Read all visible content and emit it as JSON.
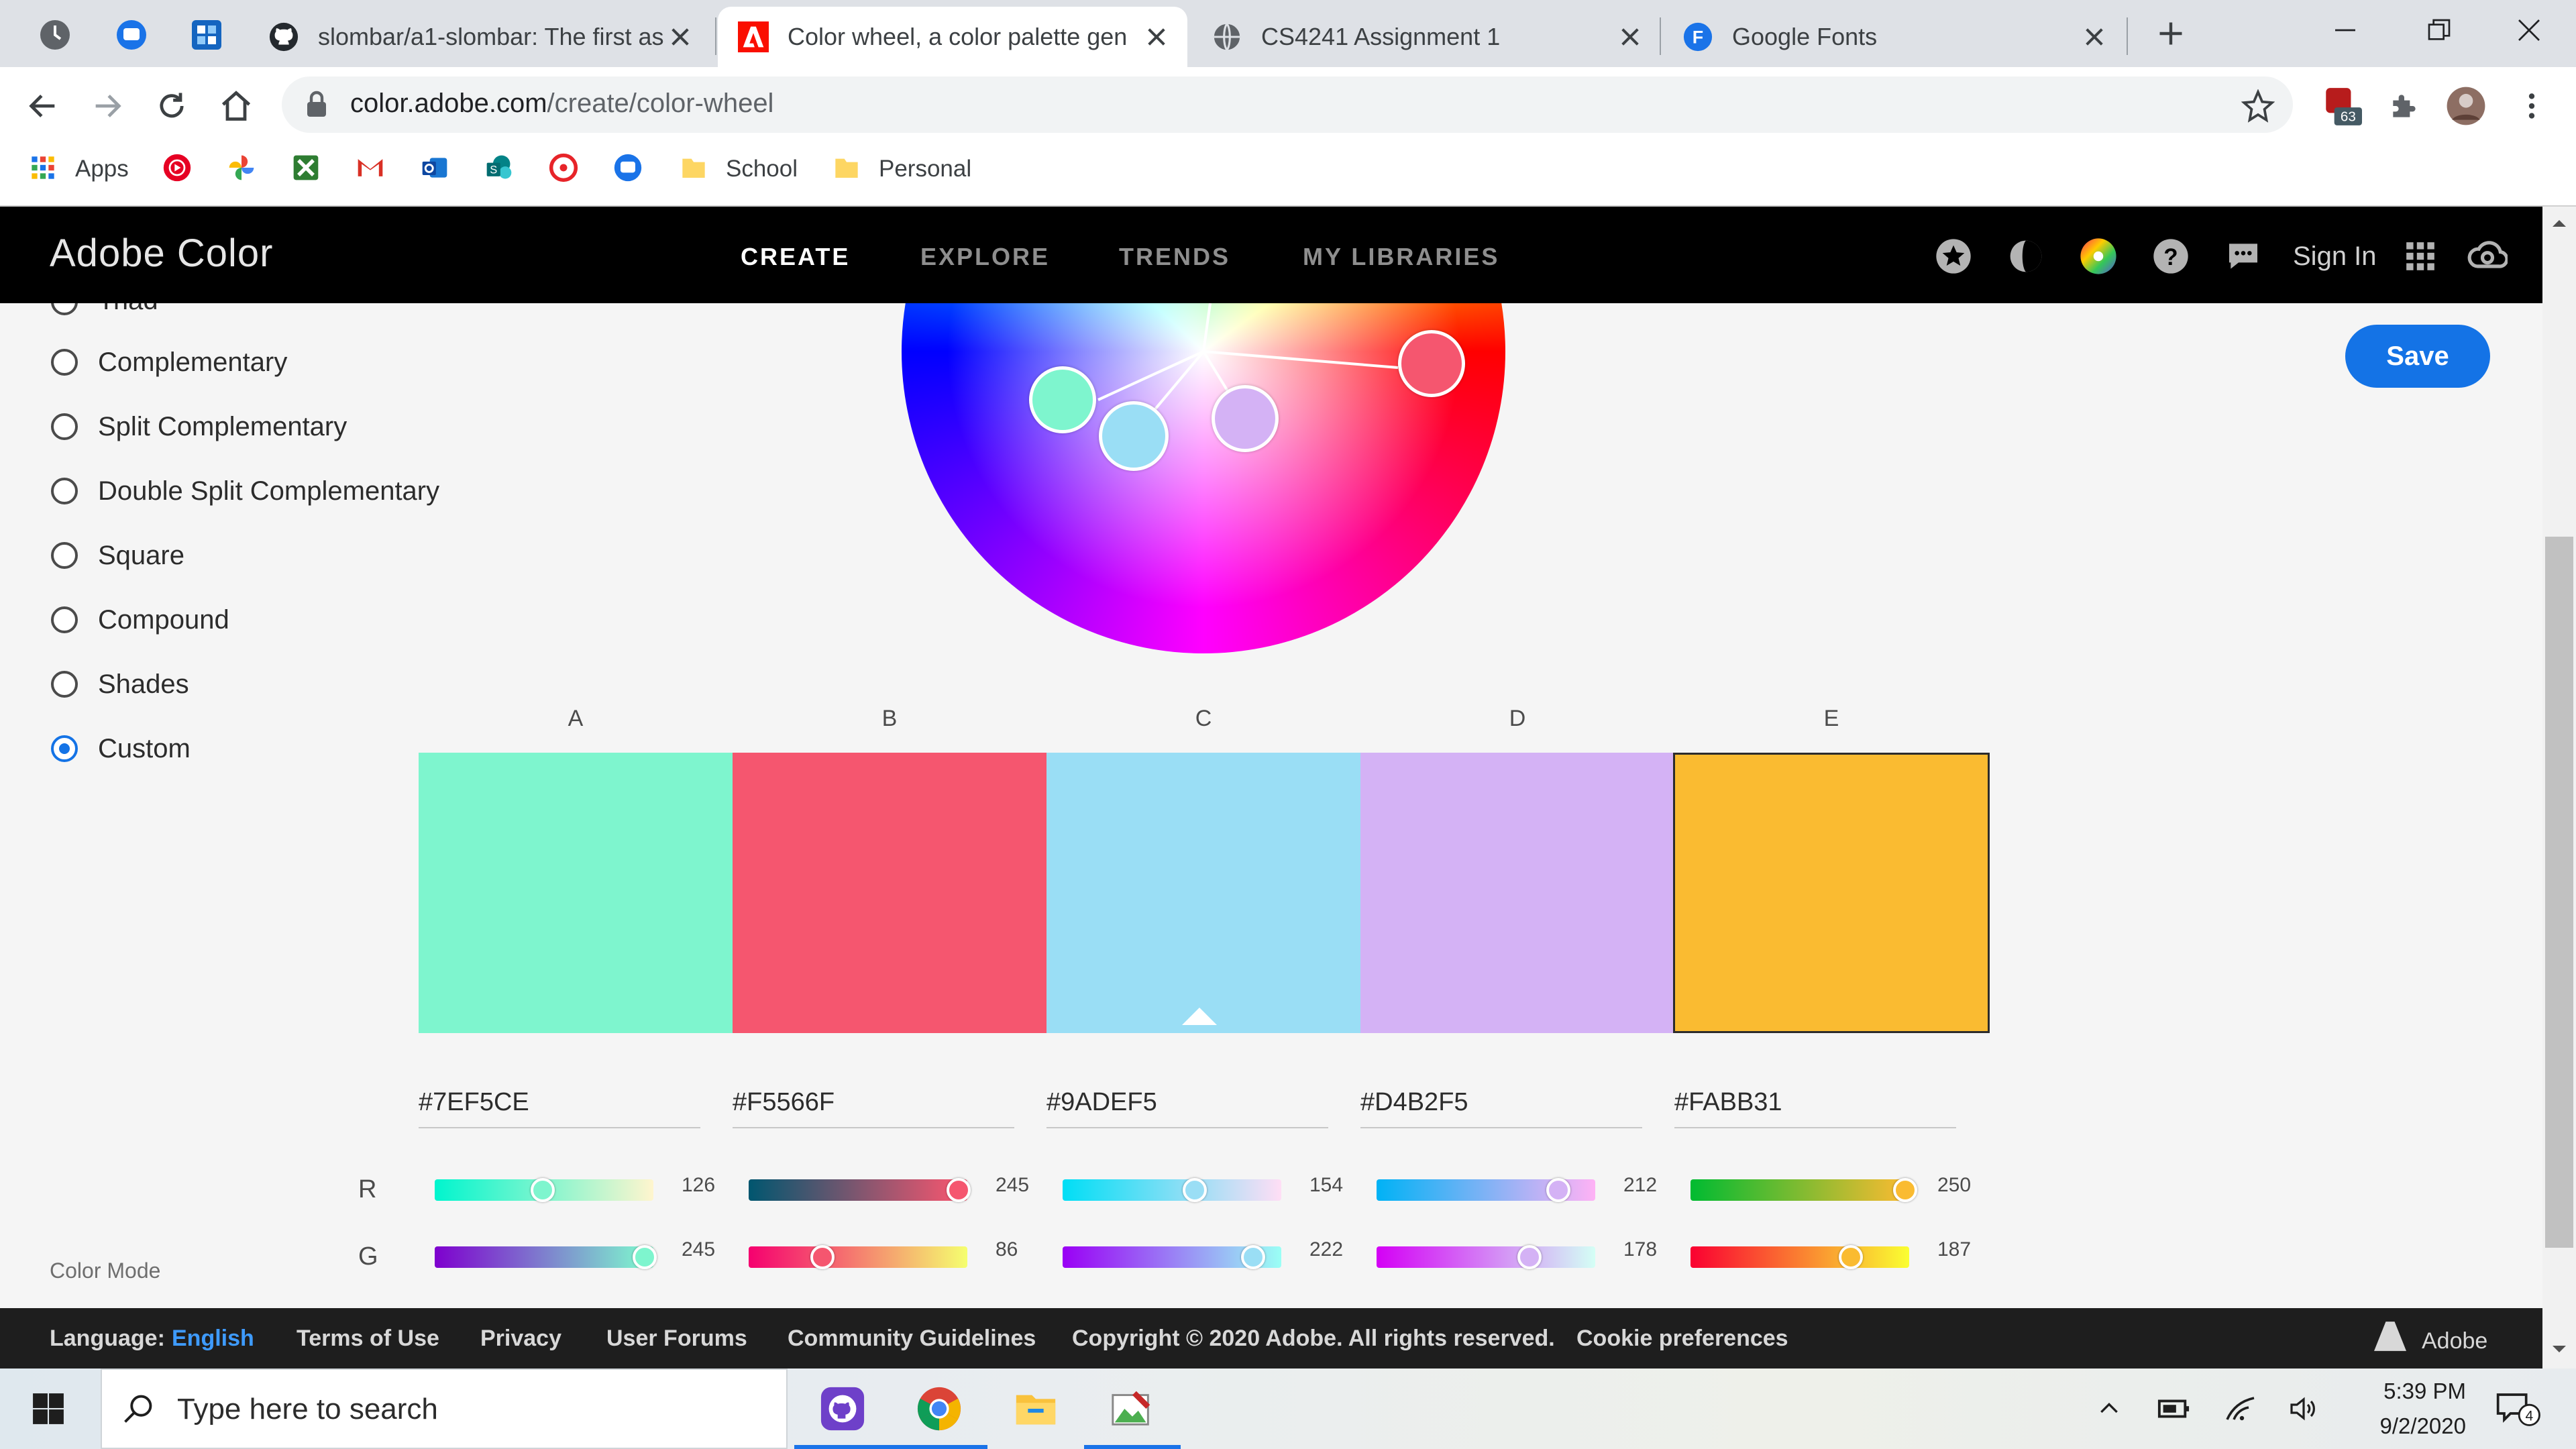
{
  "browser": {
    "tabs": [
      {
        "title": "slombar/a1-slombar: The first as",
        "favicon": "github-icon"
      },
      {
        "title": "Color wheel, a color palette gen",
        "favicon": "adobe-icon",
        "active": true
      },
      {
        "title": "CS4241 Assignment 1",
        "favicon": "globe-icon"
      },
      {
        "title": "Google Fonts",
        "favicon": "google-fonts-icon",
        "favicon_letter": "F"
      }
    ],
    "url_host": "color.adobe.com",
    "url_path": "/create/color-wheel",
    "extension_badge": "63",
    "bookmarks": [
      {
        "label": "Apps",
        "icon": "apps-grid-icon"
      },
      {
        "label": "School",
        "icon": "folder-icon"
      },
      {
        "label": "Personal",
        "icon": "folder-icon"
      }
    ]
  },
  "app": {
    "brand": "Adobe Color",
    "nav": [
      "CREATE",
      "EXPLORE",
      "TRENDS",
      "MY LIBRARIES"
    ],
    "active_nav": "CREATE",
    "sign_in": "Sign In",
    "save": "Save"
  },
  "harmony_rules": {
    "partial_top": "Triad",
    "options": [
      "Complementary",
      "Split Complementary",
      "Double Split Complementary",
      "Square",
      "Compound",
      "Shades",
      "Custom"
    ],
    "selected": "Custom",
    "color_mode_label": "Color Mode"
  },
  "palette": {
    "columns": [
      {
        "label": "A",
        "hex": "#7EF5CE",
        "r": 126,
        "g": 245
      },
      {
        "label": "B",
        "hex": "#F5566F",
        "r": 245,
        "g": 86
      },
      {
        "label": "C",
        "hex": "#9ADEF5",
        "r": 154,
        "g": 222
      },
      {
        "label": "D",
        "hex": "#D4B2F5",
        "r": 212,
        "g": 178
      },
      {
        "label": "E",
        "hex": "#FABB31",
        "r": 250,
        "g": 187
      }
    ],
    "selected_column": "E",
    "caret_column": "C",
    "channels": [
      "R",
      "G"
    ]
  },
  "footer": {
    "language_label": "Language:",
    "language_value": "English",
    "links": [
      "Terms of Use",
      "Privacy",
      "User Forums",
      "Community Guidelines"
    ],
    "copyright": "Copyright © 2020 Adobe. All rights reserved.",
    "cookie": "Cookie preferences",
    "adobe": "Adobe"
  },
  "taskbar": {
    "search_placeholder": "Type here to search",
    "time": "5:39 PM",
    "date": "9/2/2020",
    "notification_count": "4"
  },
  "colors": {
    "accent": "#1473e6",
    "header_bg": "#000000",
    "footer_bg": "#1e1e1e"
  }
}
